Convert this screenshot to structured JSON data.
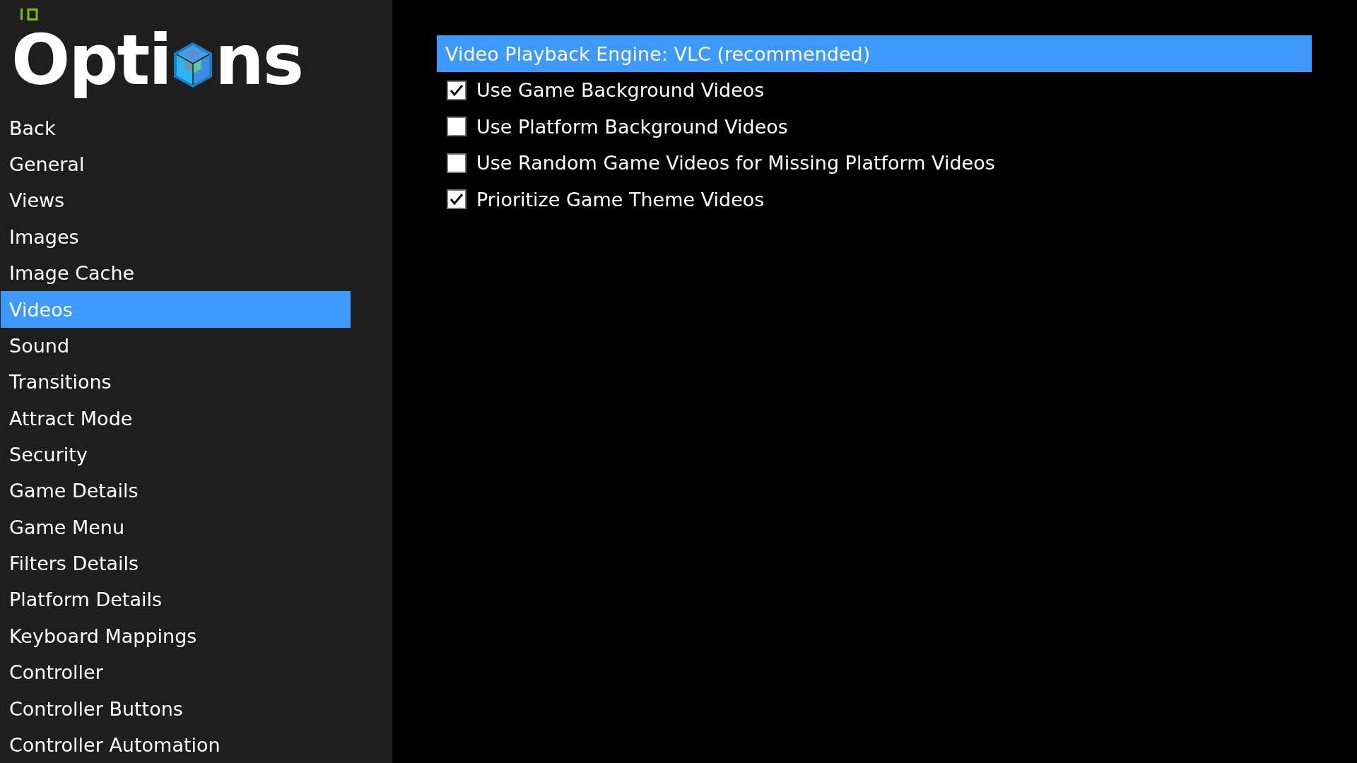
{
  "logo": {
    "title_start": "Opti",
    "title_end": "ns"
  },
  "sidebar": {
    "items": [
      {
        "label": "Back",
        "selected": false
      },
      {
        "label": "General",
        "selected": false
      },
      {
        "label": "Views",
        "selected": false
      },
      {
        "label": "Images",
        "selected": false
      },
      {
        "label": "Image Cache",
        "selected": false
      },
      {
        "label": "Videos",
        "selected": true
      },
      {
        "label": "Sound",
        "selected": false
      },
      {
        "label": "Transitions",
        "selected": false
      },
      {
        "label": "Attract Mode",
        "selected": false
      },
      {
        "label": "Security",
        "selected": false
      },
      {
        "label": "Game Details",
        "selected": false
      },
      {
        "label": "Game Menu",
        "selected": false
      },
      {
        "label": "Filters Details",
        "selected": false
      },
      {
        "label": "Platform Details",
        "selected": false
      },
      {
        "label": "Keyboard Mappings",
        "selected": false
      },
      {
        "label": "Controller",
        "selected": false
      },
      {
        "label": "Controller Buttons",
        "selected": false
      },
      {
        "label": "Controller Automation",
        "selected": false
      }
    ]
  },
  "options": [
    {
      "kind": "choice",
      "label": "Video Playback Engine: VLC (recommended)",
      "selected": true
    },
    {
      "kind": "checkbox",
      "label": "Use Game Background Videos",
      "checked": true
    },
    {
      "kind": "checkbox",
      "label": "Use Platform Background Videos",
      "checked": false
    },
    {
      "kind": "checkbox",
      "label": "Use Random Game Videos for Missing Platform Videos",
      "checked": false
    },
    {
      "kind": "checkbox",
      "label": "Prioritize Game Theme Videos",
      "checked": true
    }
  ]
}
